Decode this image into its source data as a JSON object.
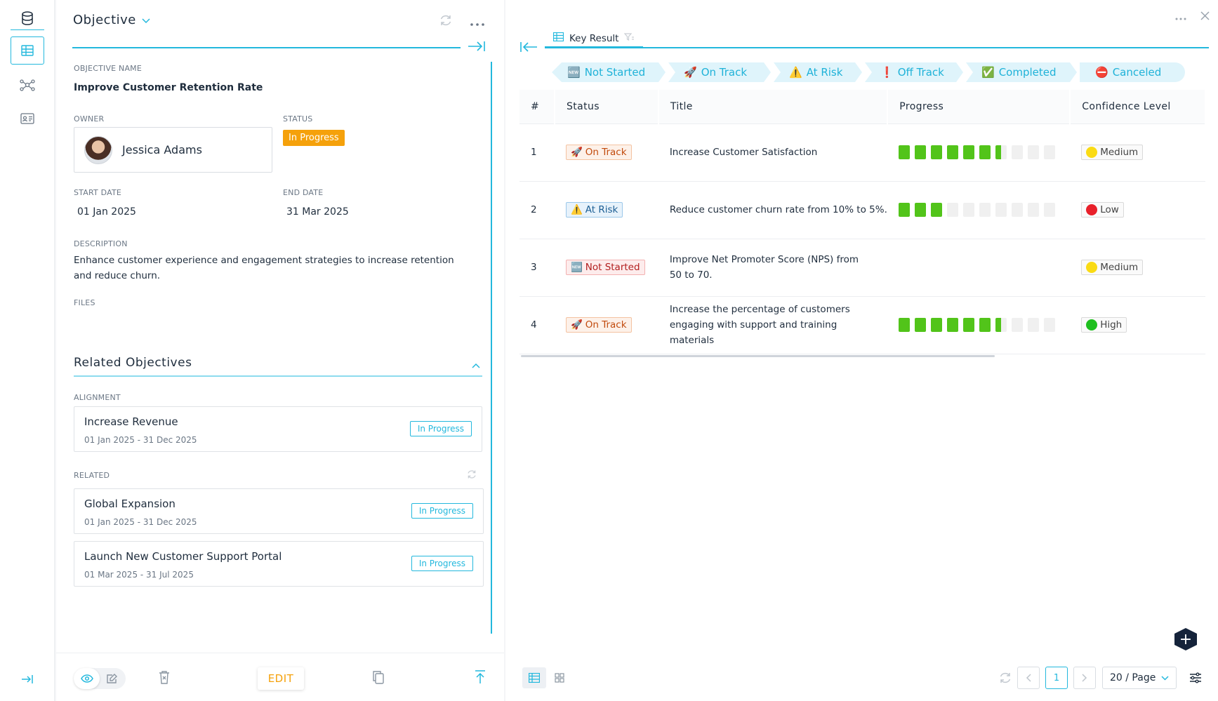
{
  "objective_panel": {
    "title": "Objective",
    "name_label": "OBJECTIVE NAME",
    "name_value": "Improve Customer Retention Rate",
    "owner_label": "OWNER",
    "owner_name": "Jessica Adams",
    "status_label": "STATUS",
    "status_value": "In Progress",
    "start_label": "START DATE",
    "start_value": "01 Jan 2025",
    "end_label": "END DATE",
    "end_value": "31 Mar 2025",
    "description_label": "DESCRIPTION",
    "description_value": "Enhance customer experience and engagement strategies to increase retention and reduce churn.",
    "files_label": "FILES",
    "related_title": "Related Objectives",
    "alignment_label": "ALIGNMENT",
    "related_label": "RELATED",
    "alignment_items": [
      {
        "title": "Increase Revenue",
        "dates": "01 Jan 2025 - 31 Dec 2025",
        "status": "In Progress"
      }
    ],
    "related_items": [
      {
        "title": "Global Expansion",
        "dates": "01 Jan 2025 - 31 Dec 2025",
        "status": "In Progress"
      },
      {
        "title": "Launch New Customer Support Portal",
        "dates": "01 Mar 2025 - 31 Jul 2025",
        "status": "In Progress"
      }
    ],
    "edit_label": "EDIT"
  },
  "key_result_panel": {
    "tab_label": "Key Result",
    "filters": [
      {
        "emoji": "🆕",
        "label": "Not Started"
      },
      {
        "emoji": "🚀",
        "label": "On Track"
      },
      {
        "emoji": "⚠️",
        "label": "At Risk"
      },
      {
        "emoji": "❗",
        "label": "Off Track"
      },
      {
        "emoji": "✅",
        "label": "Completed"
      },
      {
        "emoji": "⛔",
        "label": "Canceled"
      }
    ],
    "columns": [
      "#",
      "Status",
      "Title",
      "Progress",
      "Confidence Level"
    ],
    "rows": [
      {
        "num": "1",
        "status_emoji": "🚀",
        "status": "On Track",
        "title": "Increase Customer Satisfaction",
        "progress_segments": 6.5,
        "confidence": "Medium",
        "confidence_color": "#fadb14"
      },
      {
        "num": "2",
        "status_emoji": "⚠️",
        "status": "At Risk",
        "title": "Reduce customer churn rate from 10% to 5%.",
        "progress_segments": 3,
        "confidence": "Low",
        "confidence_color": "#e8202a"
      },
      {
        "num": "3",
        "status_emoji": "🆕",
        "status": "Not Started",
        "title": "Improve Net Promoter Score (NPS) from 50 to 70.",
        "progress_segments": null,
        "confidence": "Medium",
        "confidence_color": "#fadb14"
      },
      {
        "num": "4",
        "status_emoji": "🚀",
        "status": "On Track",
        "title": "Increase the percentage of customers engaging with support and training materials",
        "progress_segments": 6.5,
        "confidence": "High",
        "confidence_color": "#1fbf1f"
      }
    ],
    "pagination": {
      "current_page": "1",
      "page_size": "20 / Page"
    }
  },
  "colors": {
    "accent": "#23b8dd",
    "status_in_progress": "#f5a10b",
    "progress_green": "#52c41a"
  }
}
